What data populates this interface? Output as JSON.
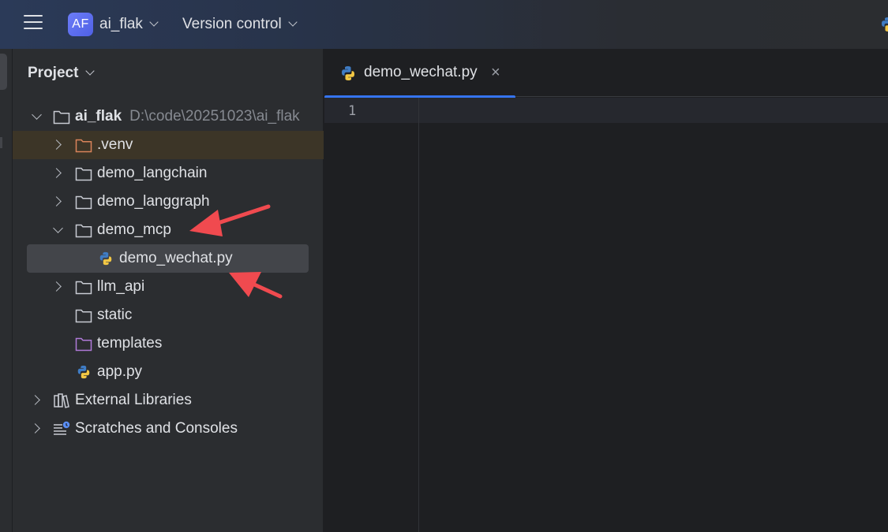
{
  "titlebar": {
    "project_badge": "AF",
    "project_name": "ai_flak",
    "vcs_label": "Version control"
  },
  "project_panel": {
    "title": "Project",
    "root": {
      "label": "ai_flak",
      "path": "D:\\code\\20251023\\ai_flak"
    },
    "items": [
      {
        "label": ".venv"
      },
      {
        "label": "demo_langchain"
      },
      {
        "label": "demo_langgraph"
      },
      {
        "label": "demo_mcp"
      },
      {
        "label": "demo_wechat.py"
      },
      {
        "label": "llm_api"
      },
      {
        "label": "static"
      },
      {
        "label": "templates"
      },
      {
        "label": "app.py"
      }
    ],
    "external_libraries": "External Libraries",
    "scratches": "Scratches and Consoles"
  },
  "editor": {
    "tab_label": "demo_wechat.py",
    "tab_close": "×",
    "line_number": "1"
  },
  "colors": {
    "accent": "#3574f0",
    "annotation_arrow": "#f04a4f",
    "venv_folder": "#d9845a",
    "templates_folder": "#b07ad9"
  }
}
